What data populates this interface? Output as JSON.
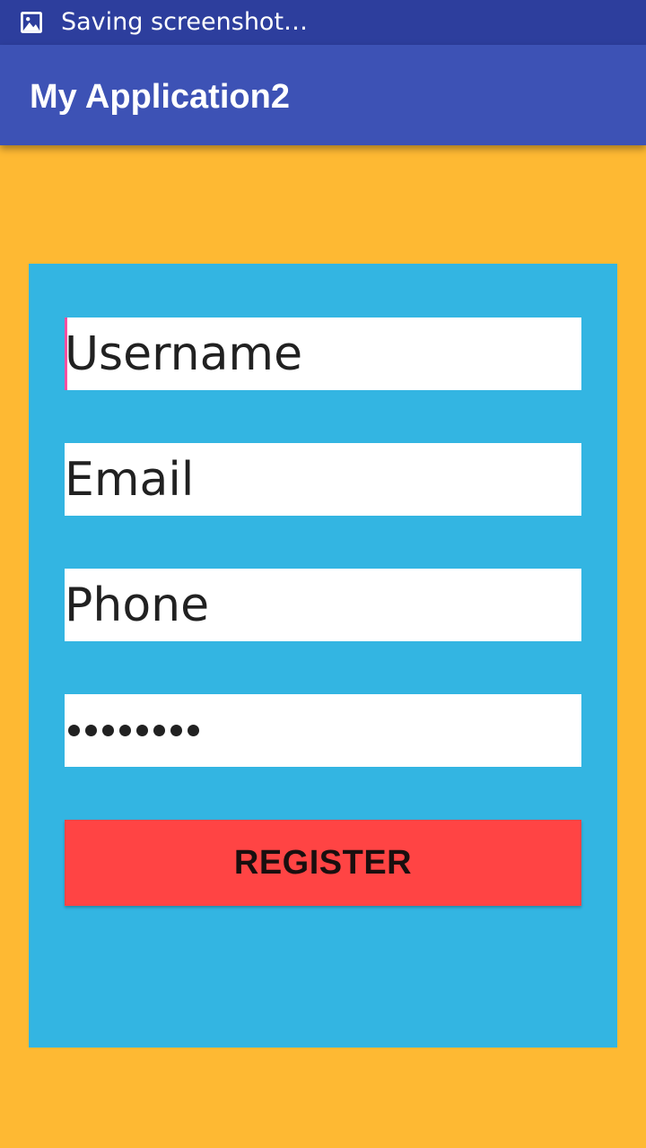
{
  "status_bar": {
    "icon": "image-icon",
    "text": "Saving screenshot…",
    "background": "#2D3E9D"
  },
  "app_bar": {
    "title": "My Application2",
    "background": "#3D52B5"
  },
  "colors": {
    "page_background": "#FEB933",
    "card_background": "#33B5E2",
    "button_background": "#FF4444",
    "cursor": "#FF4FA0"
  },
  "form": {
    "username": {
      "value": "Username"
    },
    "email": {
      "value": "Email"
    },
    "phone": {
      "value": "Phone"
    },
    "password": {
      "masked_value": "••••••••",
      "length": 8
    },
    "register_label": "REGISTER"
  }
}
